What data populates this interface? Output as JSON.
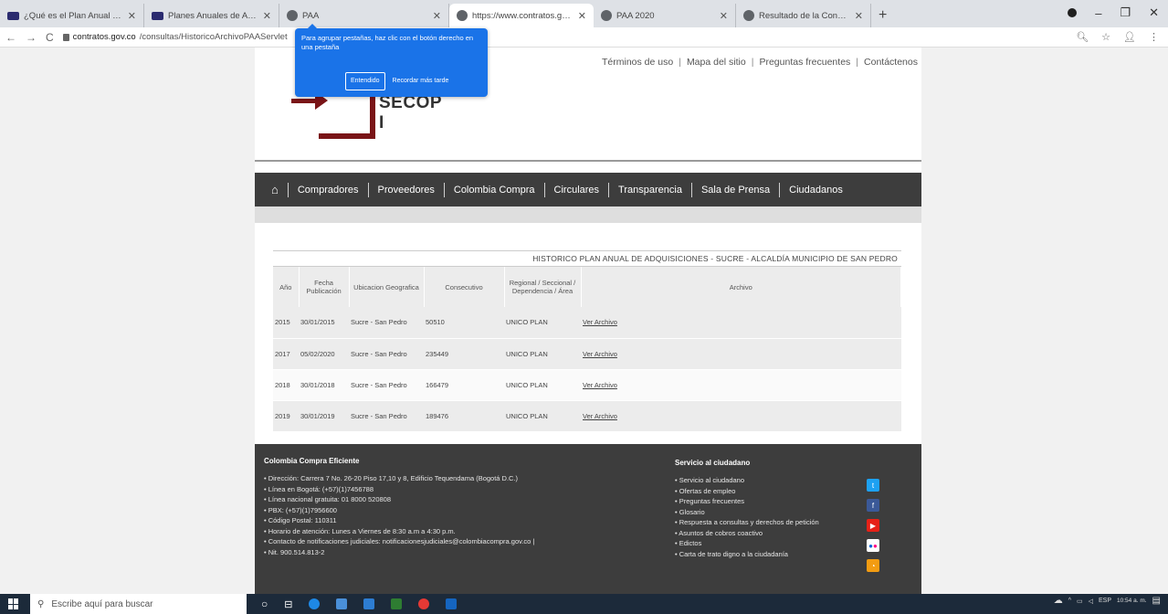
{
  "browser": {
    "tabs": [
      {
        "title": "¿Qué es el Plan Anual de Adqui",
        "fav": "dark"
      },
      {
        "title": "Planes Anuales de Adquisiciones",
        "fav": "dark"
      },
      {
        "title": "PAA",
        "fav": "gray"
      },
      {
        "title": "https://www.contratos.gov.co/c",
        "fav": "gray",
        "active": true
      },
      {
        "title": "PAA 2020",
        "fav": "gray"
      },
      {
        "title": "Resultado de la Consulta",
        "fav": "gray"
      }
    ],
    "new_tab": "+",
    "url_host": "contratos.gov.co",
    "url_path": "/consultas/HistoricoArchivoPAAServlet"
  },
  "tab_tooltip": {
    "text": "Para agrupar pestañas, haz clic con el botón derecho en una pestaña",
    "primary_button": "Entendido",
    "secondary_button": "Recordar más tarde"
  },
  "header": {
    "links": [
      "Términos de uso",
      "Mapa del sitio",
      "Preguntas frecuentes",
      "Contáctenos"
    ],
    "logo_text": "SECOP I"
  },
  "nav": {
    "items": [
      "Compradores",
      "Proveedores",
      "Colombia Compra",
      "Circulares",
      "Transparencia",
      "Sala de Prensa",
      "Ciudadanos"
    ]
  },
  "table": {
    "caption": "HISTORICO PLAN ANUAL DE ADQUISICIONES - SUCRE - ALCALDÍA MUNICIPIO DE SAN PEDRO",
    "headers": [
      "Año",
      "Fecha Publicación",
      "Ubicacion Geografica",
      "Consecutivo",
      "Regional / Seccional / Dependencia / Área",
      "Archivo"
    ],
    "rows": [
      {
        "anio": "2015",
        "fecha": "30/01/2015",
        "ubicacion": "Sucre - San Pedro",
        "consecutivo": "50510",
        "regional": "UNICO PLAN",
        "archivo": "Ver Archivo"
      },
      {
        "anio": "2017",
        "fecha": "05/02/2020",
        "ubicacion": "Sucre - San Pedro",
        "consecutivo": "235449",
        "regional": "UNICO PLAN",
        "archivo": "Ver Archivo"
      },
      {
        "anio": "2018",
        "fecha": "30/01/2018",
        "ubicacion": "Sucre - San Pedro",
        "consecutivo": "166479",
        "regional": "UNICO PLAN",
        "archivo": "Ver Archivo"
      },
      {
        "anio": "2019",
        "fecha": "30/01/2019",
        "ubicacion": "Sucre - San Pedro",
        "consecutivo": "189476",
        "regional": "UNICO PLAN",
        "archivo": "Ver Archivo"
      }
    ]
  },
  "footer": {
    "left_title": "Colombia Compra Eficiente",
    "left_items": [
      "Dirección: Carrera 7 No. 26-20 Piso 17,10 y 8, Edificio Tequendama (Bogotá D.C.)",
      "Línea en Bogotá: (+57)(1)7456788",
      "Línea nacional gratuita: 01 8000 520808",
      "PBX: (+57)(1)7956600",
      "Código Postal: 110311",
      "Horario de atención: Lunes a Viernes de 8:30 a.m a 4:30 p.m.",
      "Contacto de notificaciones judiciales:   notificacionesjudiciales@colombiacompra.gov.co   |",
      "Nit. 900.514.813-2"
    ],
    "right_title": "Servicio al ciudadano",
    "right_items": [
      "Servicio al ciudadano",
      "Ofertas de empleo",
      "Preguntas frecuentes",
      "Glosario",
      "Respuesta a consultas y derechos de petición",
      "Asuntos de cobros coactivo",
      "Edictos",
      "Carta de trato digno a la ciudadanía"
    ],
    "social": [
      {
        "icon": "twitter-icon",
        "color": "#1da1f2"
      },
      {
        "icon": "facebook-icon",
        "color": "#3b5998"
      },
      {
        "icon": "youtube-icon",
        "color": "#e62117"
      },
      {
        "icon": "flickr-icon",
        "color": "#ffffff"
      },
      {
        "icon": "rss-icon",
        "color": "#f39c12"
      }
    ]
  },
  "taskbar": {
    "search_placeholder": "Escribe aquí para buscar",
    "lang": "ESP",
    "time": "10:54 a. m."
  },
  "colors": {
    "tooltip_blue": "#1a73e8",
    "nav_dark": "#3d3d3d",
    "logo_red": "#7a1417"
  }
}
